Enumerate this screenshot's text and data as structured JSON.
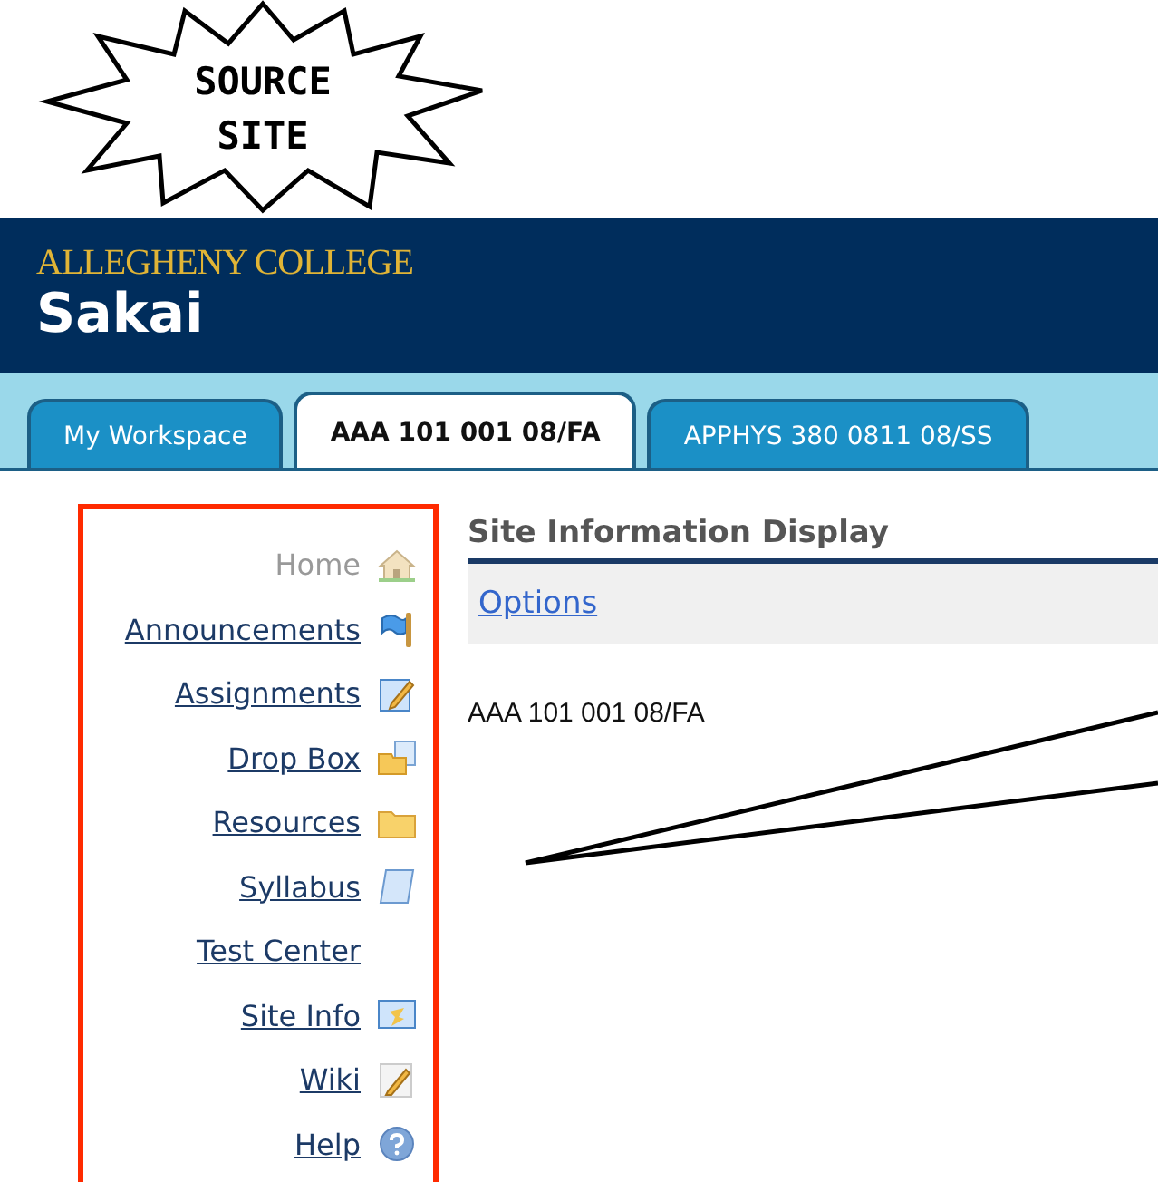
{
  "callout": {
    "text": "SOURCE SITE"
  },
  "header": {
    "logo": "ALLEGHENY COLLEGE",
    "product": "Sakai"
  },
  "tabs": [
    {
      "label": "My Workspace",
      "selected": false
    },
    {
      "label": "AAA 101 001 08/FA",
      "selected": true
    },
    {
      "label": "APPHYS 380 0811 08/SS",
      "selected": false
    }
  ],
  "nav": {
    "items": [
      {
        "label": "Home",
        "selected": true
      },
      {
        "label": "Announcements",
        "selected": false
      },
      {
        "label": "Assignments",
        "selected": false
      },
      {
        "label": "Drop Box",
        "selected": false
      },
      {
        "label": "Resources",
        "selected": false
      },
      {
        "label": "Syllabus",
        "selected": false
      },
      {
        "label": "Test Center",
        "selected": false
      },
      {
        "label": "Site Info",
        "selected": false
      },
      {
        "label": "Wiki",
        "selected": false
      },
      {
        "label": "Help",
        "selected": false
      }
    ]
  },
  "main": {
    "title": "Site Information Display",
    "options_link": "Options",
    "site_name": "AAA 101 001 08/FA"
  }
}
